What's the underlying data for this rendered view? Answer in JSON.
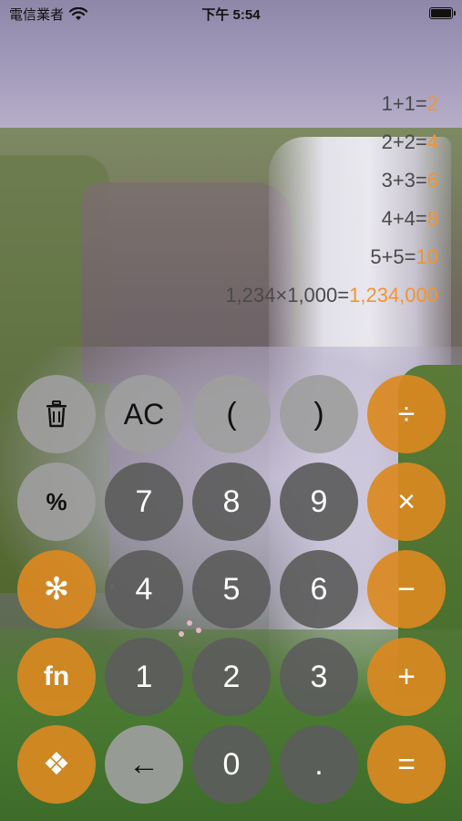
{
  "status_bar": {
    "carrier": "電信業者",
    "time": "下午 5:54"
  },
  "history": [
    {
      "expression": "1+1=",
      "result": "2"
    },
    {
      "expression": "2+2=",
      "result": "4"
    },
    {
      "expression": "3+3=",
      "result": "6"
    },
    {
      "expression": "4+4=",
      "result": "8"
    },
    {
      "expression": "5+5=",
      "result": "10"
    },
    {
      "expression": "1,234×1,000=",
      "result": "1,234,000"
    }
  ],
  "keys": {
    "ac": "AC",
    "paren_open": "(",
    "paren_close": ")",
    "divide": "÷",
    "percent": "%",
    "seven": "7",
    "eight": "8",
    "nine": "9",
    "multiply": "×",
    "asterisk": "✻",
    "four": "4",
    "five": "5",
    "six": "6",
    "minus": "−",
    "fn": "fn",
    "one": "1",
    "two": "2",
    "three": "3",
    "plus": "+",
    "diamond": "❖",
    "backspace": "←",
    "zero": "0",
    "dot": ".",
    "equals": "="
  },
  "icons": {
    "wifi": "wifi-icon",
    "battery": "battery-icon",
    "trash": "trash-icon"
  },
  "colors": {
    "accent": "#f2942f",
    "key_orange": "#da8921",
    "key_dark": "#5c5c5c",
    "key_light": "#9e9e9e"
  }
}
